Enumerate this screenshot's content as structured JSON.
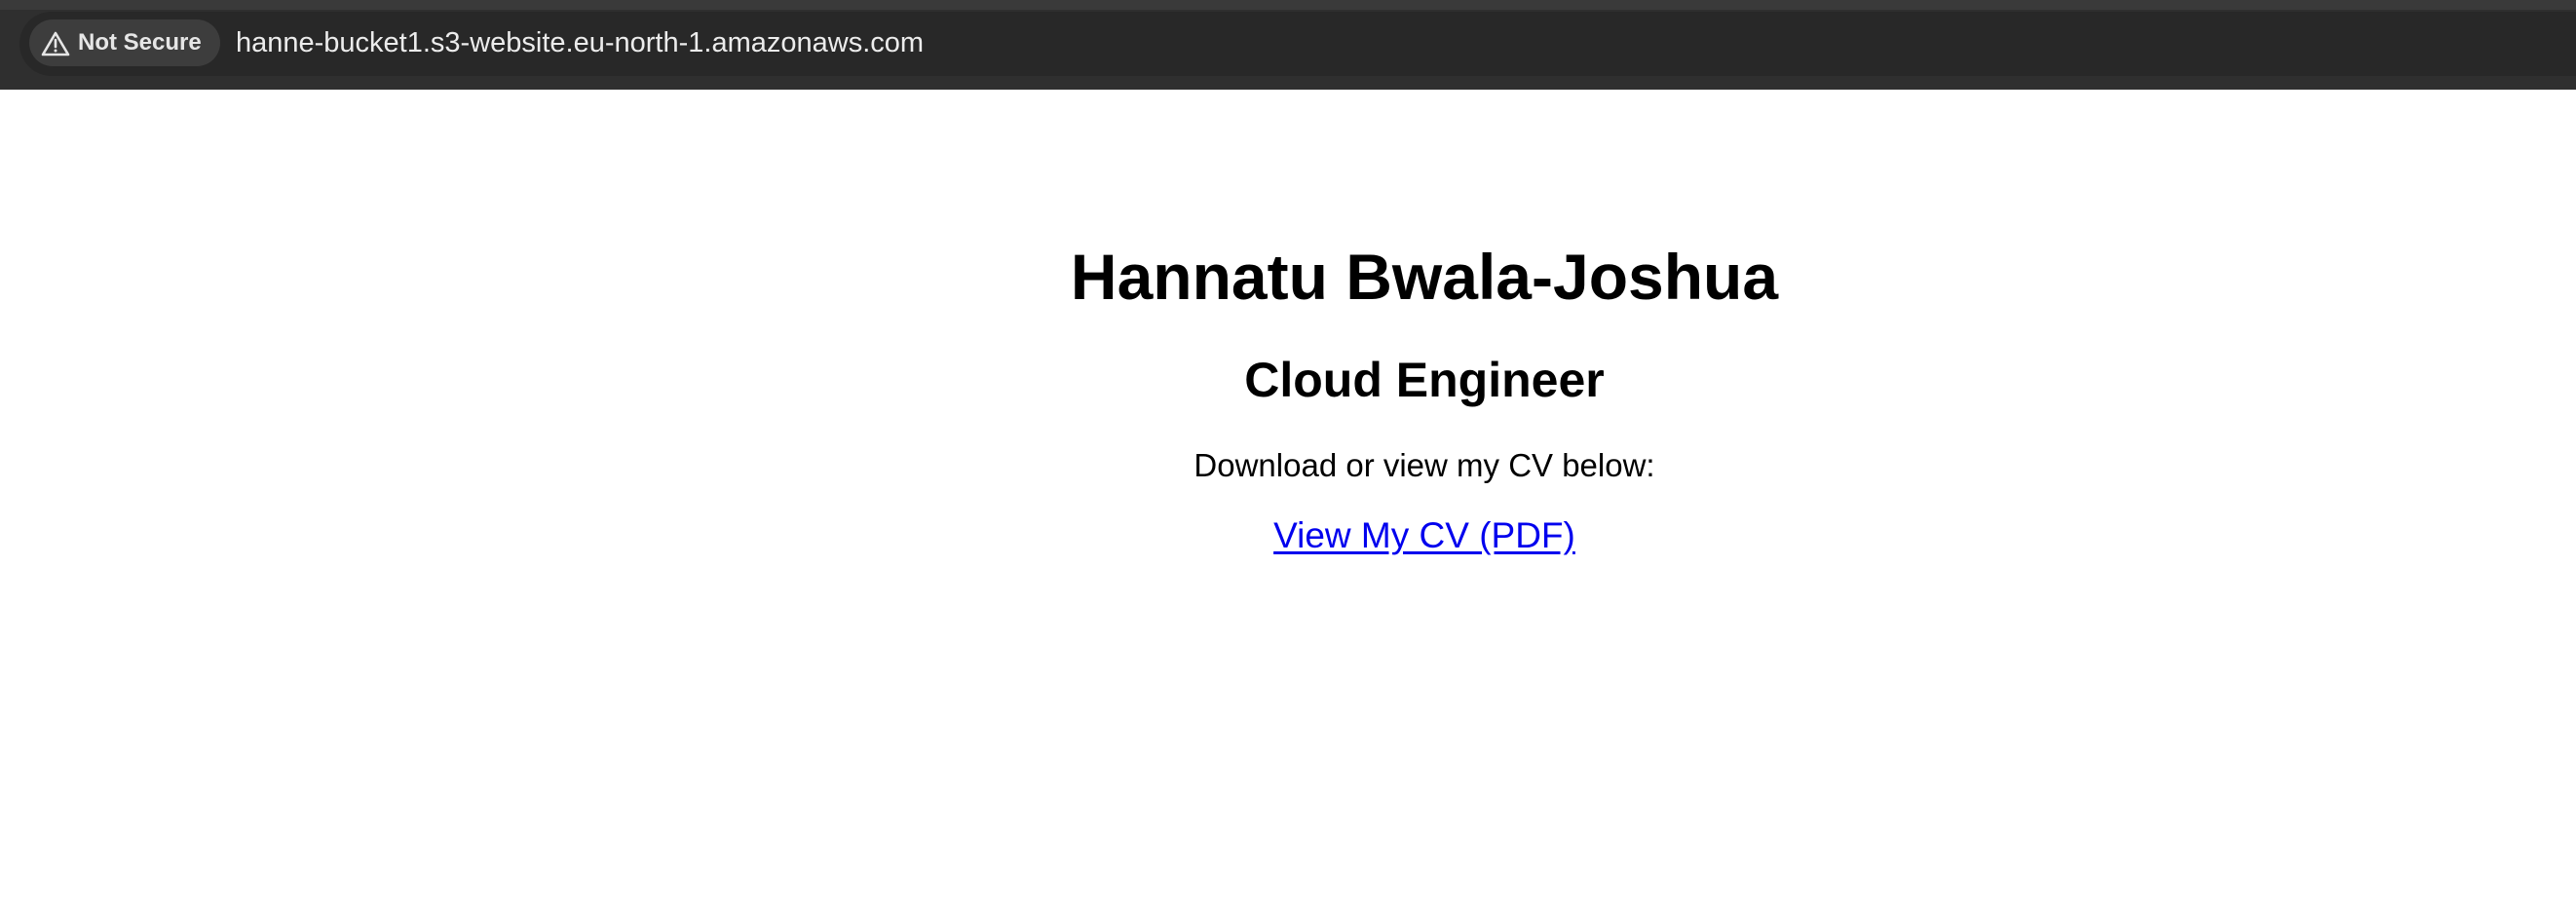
{
  "browser": {
    "security_label": "Not Secure",
    "url": "hanne-bucket1.s3-website.eu-north-1.amazonaws.com",
    "security_icon": "warning-triangle-icon",
    "toolbar_color": "#2f2f2f",
    "address_bar_color": "#282828"
  },
  "page": {
    "title": "Hannatu Bwala-Joshua",
    "subtitle": "Cloud Engineer",
    "intro": "Download or view my CV below:",
    "cv_link_label": "View My CV (PDF)",
    "link_color": "#0000ee"
  }
}
